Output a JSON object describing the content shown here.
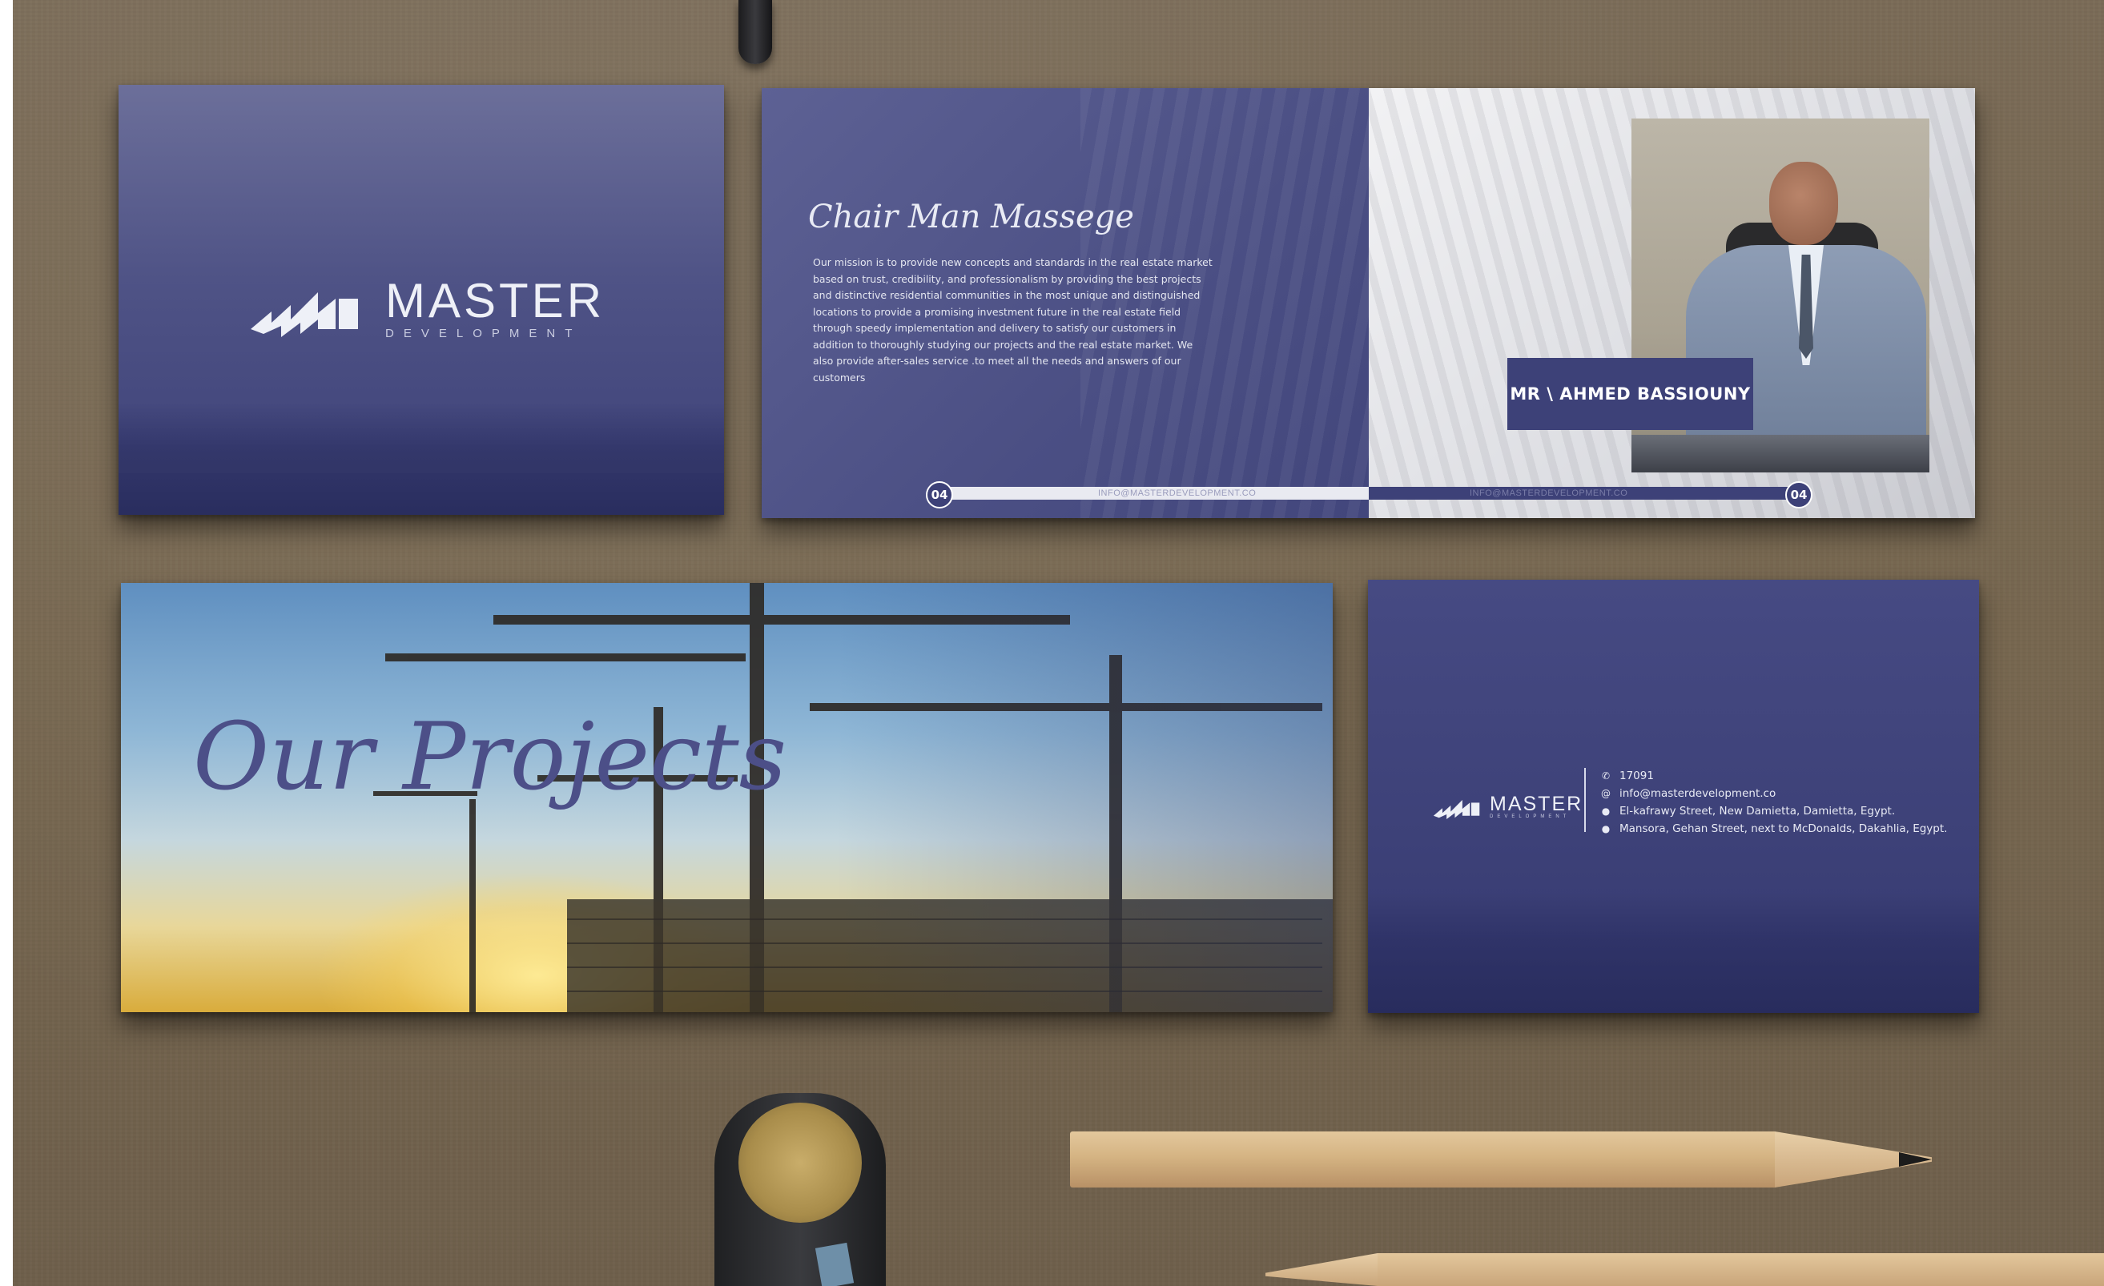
{
  "brand": {
    "name": "MASTER",
    "tagline": "DEVELOPMENT"
  },
  "chairman": {
    "heading": "Chair Man Massege",
    "message": "Our mission is to provide new concepts and standards in the real estate market based on trust, credibility, and professionalism by providing the best projects and distinctive residential communities in the most unique and distinguished locations to provide a promising investment future in the real estate field through speedy implementation and delivery to satisfy our customers in addition to thoroughly studying our projects and the real estate market. We also provide after-sales service .to meet all the needs and answers of our customers",
    "name": "MR \\ AHMED BASSIOUNY",
    "page_left": "04",
    "page_right": "04",
    "footer_email": "INFO@MASTERDEVELOPMENT.CO"
  },
  "projects": {
    "title": "Our Projects"
  },
  "contact": {
    "brand": "MASTER",
    "phone": "17091",
    "email": "info@masterdevelopment.co",
    "address_1": "El-kafrawy Street, New Damietta, Damietta, Egypt.",
    "address_2": "Mansora, Gehan Street, next to McDonalds, Dakahlia, Egypt."
  },
  "colors": {
    "navy": "#3d4178",
    "table": "#76664f",
    "script_purple": "#4c4f88"
  },
  "icons": [
    "phone-icon",
    "email-icon",
    "location-icon",
    "logo-mark-icon"
  ]
}
